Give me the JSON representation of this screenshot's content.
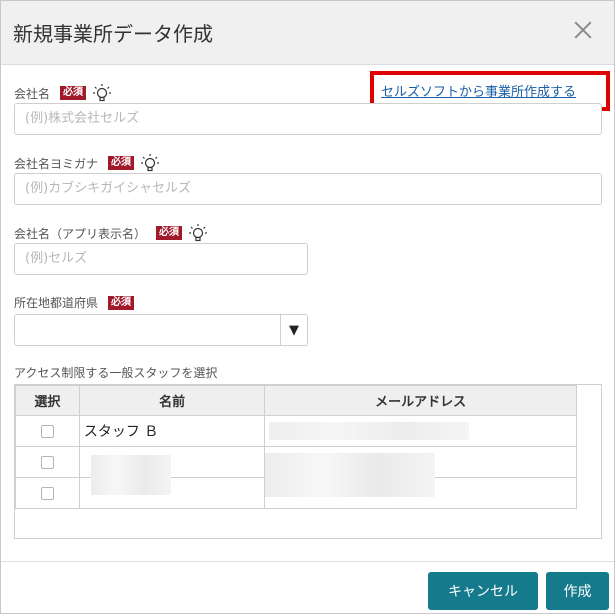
{
  "dialog": {
    "title": "新規事業所データ作成",
    "close_icon": "close-icon"
  },
  "link": {
    "text": "セルズソフトから事業所作成する"
  },
  "fields": {
    "company_name": {
      "label": "会社名",
      "required": "必須",
      "placeholder": "(例)株式会社セルズ"
    },
    "company_kana": {
      "label": "会社名ヨミガナ",
      "required": "必須",
      "placeholder": "(例)カブシキガイシャセルズ"
    },
    "company_app": {
      "label": "会社名（アプリ表示名）",
      "required": "必須",
      "placeholder": "(例)セルズ"
    },
    "prefecture": {
      "label": "所在地都道府県",
      "required": "必須",
      "value": "",
      "arrow": "▼"
    }
  },
  "staff_section": {
    "label": "アクセス制限する一般スタッフを選択",
    "columns": [
      "選択",
      "名前",
      "メールアドレス"
    ],
    "rows": [
      {
        "name": "スタッフ Ｂ",
        "email": ""
      },
      {
        "name": "",
        "email": ""
      },
      {
        "name": "",
        "email": ""
      }
    ]
  },
  "buttons": {
    "cancel": "キャンセル",
    "create": "作成"
  },
  "colors": {
    "accent": "#157a8c",
    "required_badge": "#a01a2a",
    "highlight": "#e00000",
    "link": "#1a5fa8"
  }
}
